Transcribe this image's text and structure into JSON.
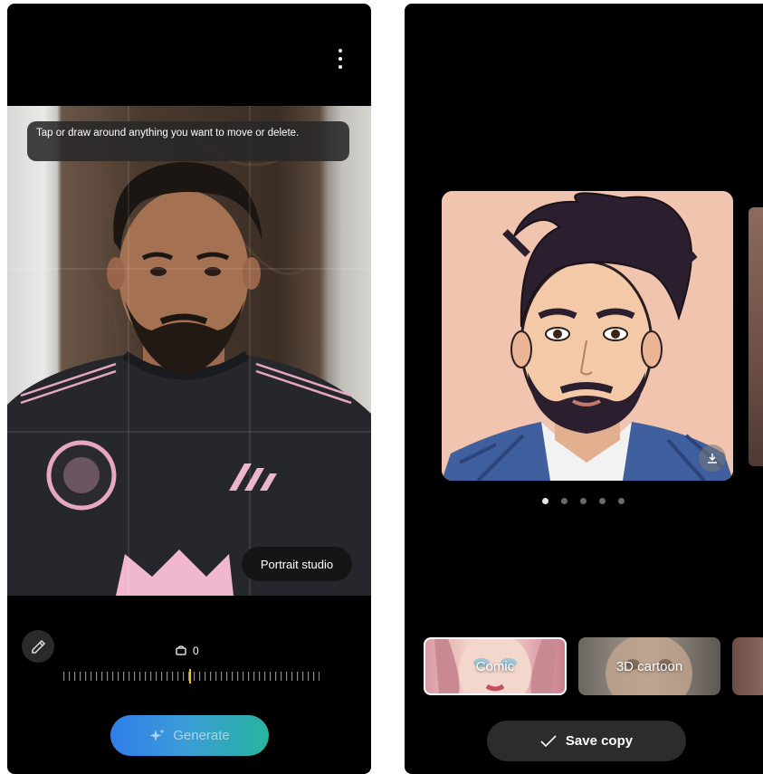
{
  "left_screen": {
    "tip_text": "Tap or draw around anything you want to move or delete.",
    "portrait_studio_label": "Portrait studio",
    "rotation_value": "0",
    "generate_label": "Generate",
    "icons": {
      "menu": "more-vertical-icon",
      "eraser": "eraser-pen-icon",
      "rotate": "rotate-icon",
      "generate": "sparkle-icon"
    },
    "colors": {
      "generate_gradient_start": "#2f7de9",
      "generate_gradient_end": "#28b4a0",
      "ruler_marker": "#f2c200"
    }
  },
  "right_screen": {
    "result_page_index": 1,
    "result_page_count": 5,
    "styles": [
      {
        "label": "Comic",
        "selected": true
      },
      {
        "label": "3D cartoon",
        "selected": false
      },
      {
        "label": "",
        "selected": false
      }
    ],
    "save_label": "Save copy",
    "icons": {
      "download": "download-icon",
      "save": "checkmark-icon"
    }
  }
}
